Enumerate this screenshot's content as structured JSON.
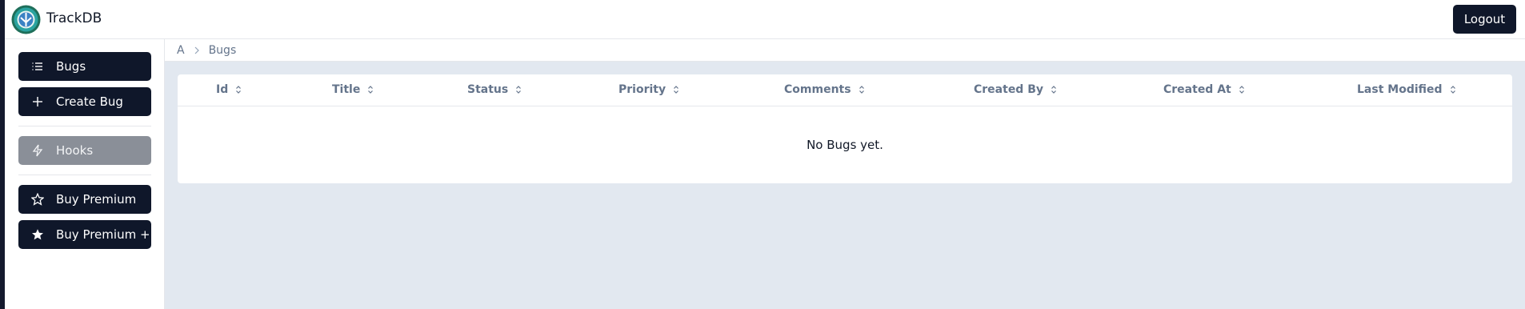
{
  "app": {
    "title": "TrackDB"
  },
  "header": {
    "logout_label": "Logout"
  },
  "sidebar": {
    "items": [
      {
        "label": "Bugs",
        "icon": "list-icon"
      },
      {
        "label": "Create Bug",
        "icon": "plus-icon"
      },
      {
        "label": "Hooks",
        "icon": "lightning-icon",
        "state": "disabled"
      },
      {
        "label": "Buy Premium",
        "icon": "star-outline-icon"
      },
      {
        "label": "Buy Premium +",
        "icon": "star-filled-icon"
      }
    ]
  },
  "breadcrumb": {
    "root": "A",
    "current": "Bugs"
  },
  "table": {
    "columns": [
      "Id",
      "Title",
      "Status",
      "Priority",
      "Comments",
      "Created By",
      "Created At",
      "Last Modified"
    ],
    "empty_message": "No Bugs yet."
  },
  "colors": {
    "primary": "#0f172a",
    "disabled": "#8a8f98",
    "content_bg": "#e2e8f0",
    "header_text": "#64748b"
  }
}
